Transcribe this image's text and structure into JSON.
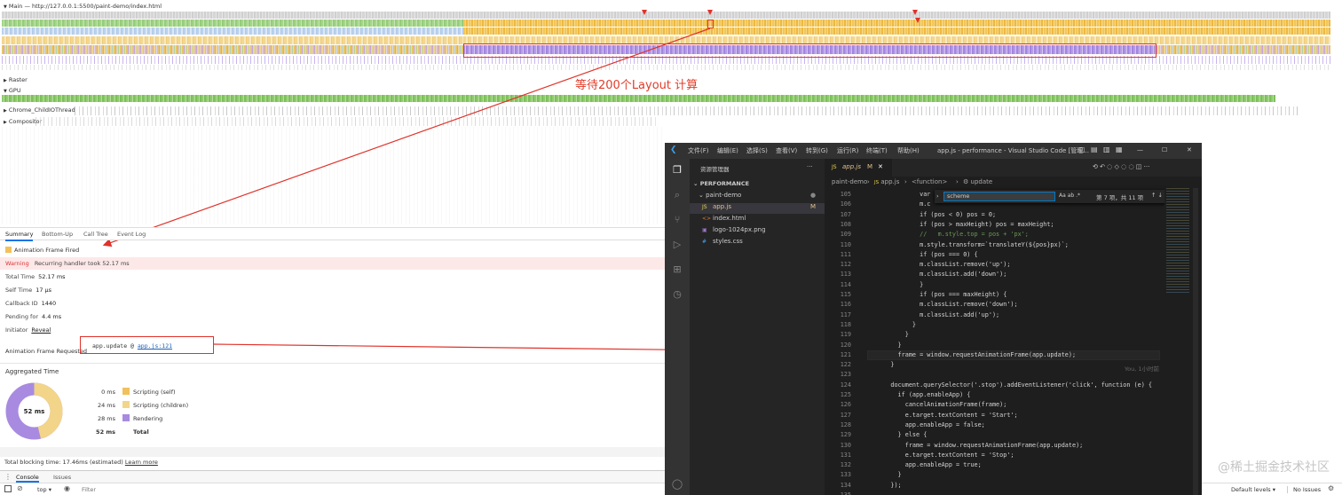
{
  "timeline": {
    "main_label": "Main — http://127.0.0.1:5500/paint-demo/index.html",
    "tracks": [
      "Raster",
      "GPU",
      "Chrome_ChildIOThread",
      "Compositor"
    ]
  },
  "annotation_text": "等待200个Layout 计算",
  "summary": {
    "tabs": [
      "Summary",
      "Bottom-Up",
      "Call Tree",
      "Event Log"
    ],
    "event_title": "Animation Frame Fired",
    "warning_label": "Warning",
    "warning_text": "Recurring handler took 52.17 ms",
    "total_time_label": "Total Time",
    "total_time": "52.17 ms",
    "self_time_label": "Self Time",
    "self_time": "17 µs",
    "callback_label": "Callback ID",
    "callback": "1440",
    "pending_label": "Pending for",
    "pending": "4.4 ms",
    "initiator_label": "Initiator",
    "initiator_link": "Reveal",
    "requested_label": "Animation Frame Requested",
    "requested_fn": "app.update @",
    "requested_link": "app.js:121",
    "aggregated_title": "Aggregated Time",
    "donut_center": "52 ms",
    "legend": [
      {
        "ms": "0 ms",
        "label": "Scripting (self)",
        "color": "#f1c15c"
      },
      {
        "ms": "24 ms",
        "label": "Scripting (children)",
        "color": "#f1c15c"
      },
      {
        "ms": "28 ms",
        "label": "Rendering",
        "color": "#a88be0"
      },
      {
        "ms": "52 ms",
        "label": "Total",
        "color": ""
      }
    ],
    "blocking_text": "Total blocking time: 17.46ms (estimated)",
    "learn_more": "Learn more"
  },
  "console": {
    "tabs": [
      "Console",
      "Issues"
    ],
    "context": "top",
    "filter_placeholder": "Filter",
    "levels": "Default levels",
    "issues": "No Issues"
  },
  "vscode": {
    "menu": [
      "文件(F)",
      "编辑(E)",
      "选择(S)",
      "查看(V)",
      "转到(G)",
      "运行(R)",
      "终端(T)",
      "帮助(H)"
    ],
    "window_title": "app.js - performance - Visual Studio Code [管理...",
    "explorer_title": "资源管理器",
    "workspace": "PERFORMANCE",
    "folder": "paint-demo",
    "files": [
      {
        "name": "app.js",
        "badge": "M",
        "icon": "JS"
      },
      {
        "name": "index.html",
        "badge": "",
        "icon": "<>"
      },
      {
        "name": "logo-1024px.png",
        "badge": "",
        "icon": "▣"
      },
      {
        "name": "styles.css",
        "badge": "",
        "icon": "#"
      }
    ],
    "tab_name": "app.js",
    "tab_badge": "M",
    "breadcrumb": [
      "paint-demo",
      "app.js",
      "<function>",
      "update"
    ],
    "find_text": "scheme",
    "find_count": "第 7 项，共 11 项",
    "blame": "You, 1小时前",
    "lines": [
      {
        "n": "105",
        "t": "            var"
      },
      {
        "n": "106",
        "t": "            m.c"
      },
      {
        "n": "107",
        "t": "            if (pos < 0) pos = 0;"
      },
      {
        "n": "108",
        "t": "            if (pos > maxHeight) pos = maxHeight;"
      },
      {
        "n": "109",
        "t": "            //   m.style.top = pos + 'px';"
      },
      {
        "n": "110",
        "t": "            m.style.transform=`translateY(${pos}px)`;"
      },
      {
        "n": "111",
        "t": "            if (pos === 0) {"
      },
      {
        "n": "112",
        "t": "            m.classList.remove('up');"
      },
      {
        "n": "113",
        "t": "            m.classList.add('down');"
      },
      {
        "n": "114",
        "t": "            }"
      },
      {
        "n": "115",
        "t": "            if (pos === maxHeight) {"
      },
      {
        "n": "116",
        "t": "            m.classList.remove('down');"
      },
      {
        "n": "117",
        "t": "            m.classList.add('up');"
      },
      {
        "n": "118",
        "t": "          }"
      },
      {
        "n": "119",
        "t": "        }"
      },
      {
        "n": "120",
        "t": "      }"
      },
      {
        "n": "121",
        "t": "      frame = window.requestAnimationFrame(app.update);"
      },
      {
        "n": "122",
        "t": "    }"
      },
      {
        "n": "123",
        "t": ""
      },
      {
        "n": "124",
        "t": "    document.querySelector('.stop').addEventListener('click', function (e) {"
      },
      {
        "n": "125",
        "t": "      if (app.enableApp) {"
      },
      {
        "n": "126",
        "t": "        cancelAnimationFrame(frame);"
      },
      {
        "n": "127",
        "t": "        e.target.textContent = 'Start';"
      },
      {
        "n": "128",
        "t": "        app.enableApp = false;"
      },
      {
        "n": "129",
        "t": "      } else {"
      },
      {
        "n": "130",
        "t": "        frame = window.requestAnimationFrame(app.update);"
      },
      {
        "n": "131",
        "t": "        e.target.textContent = 'Stop';"
      },
      {
        "n": "132",
        "t": "        app.enableApp = true;"
      },
      {
        "n": "133",
        "t": "      }"
      },
      {
        "n": "134",
        "t": "    });"
      },
      {
        "n": "135",
        "t": ""
      }
    ]
  },
  "watermark": "@稀土掘金技术社区"
}
